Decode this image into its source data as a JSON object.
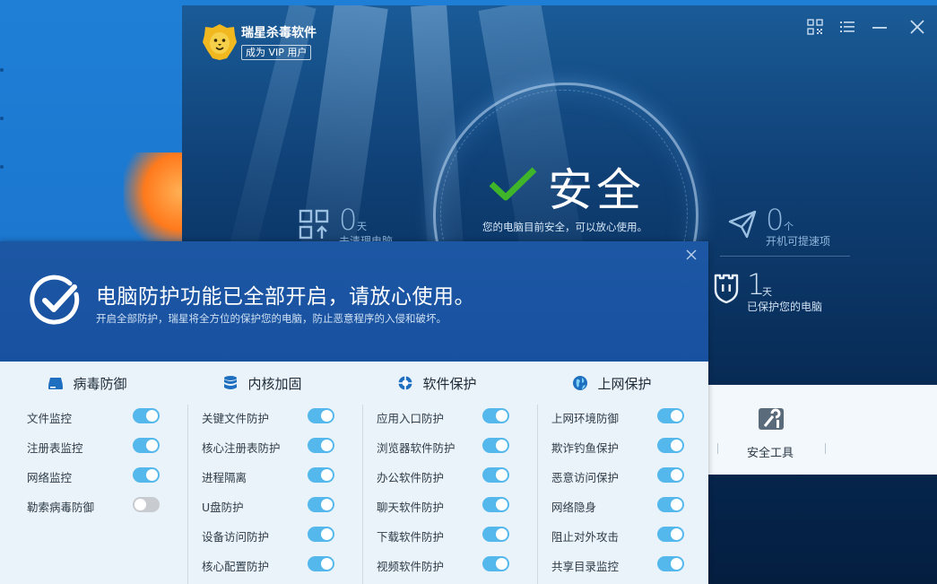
{
  "app": {
    "name": "瑞星杀毒软件",
    "vip_label": "成为 VIP 用户",
    "toolbar_icons": [
      "qr-code-icon",
      "menu-icon",
      "minimize-icon",
      "close-icon"
    ]
  },
  "status": {
    "title": "安全",
    "subtitle": "您的电脑目前安全，可以放心使用。"
  },
  "stats": {
    "uncleaned": {
      "value": "0",
      "unit": "天",
      "label": "未清理电脑"
    },
    "startup": {
      "value": "0",
      "unit": "个",
      "label": "开机可提速项"
    },
    "protected": {
      "value": "1",
      "unit": "天",
      "label": "已保护您的电脑"
    }
  },
  "bottom": {
    "tool_label": "安全工具"
  },
  "popup": {
    "title": "电脑防护功能已全部开启，请放心使用。",
    "subtitle": "开启全部防护，瑞星将全方位的保护您的电脑，防止恶意程序的入侵和破坏。",
    "columns": [
      {
        "title": "病毒防御",
        "icon": "drive-icon",
        "items": [
          {
            "label": "文件监控",
            "on": true
          },
          {
            "label": "注册表监控",
            "on": true
          },
          {
            "label": "网络监控",
            "on": true
          },
          {
            "label": "勒索病毒防御",
            "on": false
          }
        ]
      },
      {
        "title": "内核加固",
        "icon": "database-icon",
        "items": [
          {
            "label": "关键文件防护",
            "on": true
          },
          {
            "label": "核心注册表防护",
            "on": true
          },
          {
            "label": "进程隔离",
            "on": true
          },
          {
            "label": "U盘防护",
            "on": true
          },
          {
            "label": "设备访问防护",
            "on": true
          },
          {
            "label": "核心配置防护",
            "on": true
          }
        ]
      },
      {
        "title": "软件保护",
        "icon": "lifebuoy-icon",
        "items": [
          {
            "label": "应用入口防护",
            "on": true
          },
          {
            "label": "浏览器软件防护",
            "on": true
          },
          {
            "label": "办公软件防护",
            "on": true
          },
          {
            "label": "聊天软件防护",
            "on": true
          },
          {
            "label": "下载软件防护",
            "on": true
          },
          {
            "label": "视频软件防护",
            "on": true
          }
        ]
      },
      {
        "title": "上网保护",
        "icon": "globe-icon",
        "items": [
          {
            "label": "上网环境防御",
            "on": true
          },
          {
            "label": "欺诈钓鱼保护",
            "on": true
          },
          {
            "label": "恶意访问保护",
            "on": true
          },
          {
            "label": "网络隐身",
            "on": true
          },
          {
            "label": "阻止对外攻击",
            "on": true
          },
          {
            "label": "共享目录监控",
            "on": true
          }
        ]
      }
    ]
  }
}
